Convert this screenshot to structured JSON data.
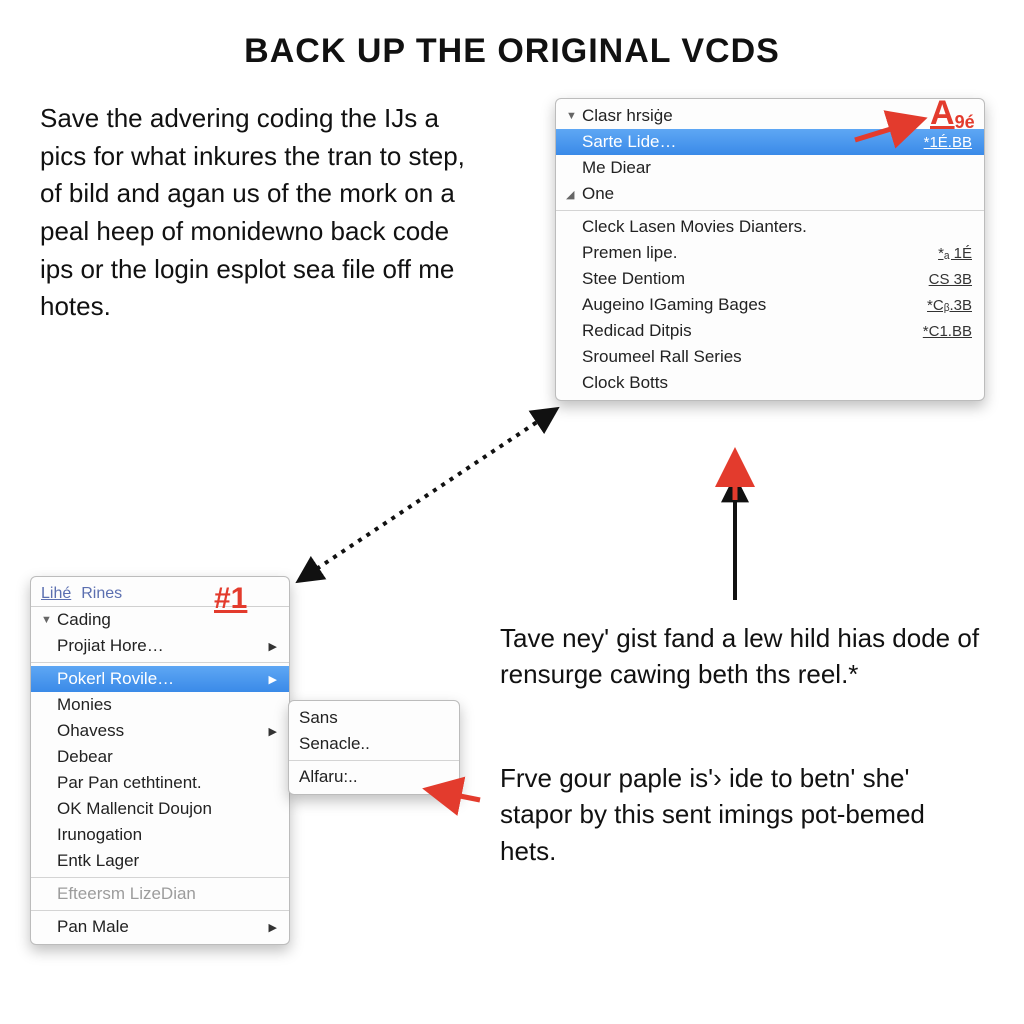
{
  "title": "BACK UP THE ORIGINAL VCDS",
  "intro": "Save the advering coding the IJs a pics for what inkures the tran to step, of bild and agan us of the mork on a peal heep of monidewno back code ips or the login esplot sea file off me hotes.",
  "para2": "Tave ney' gist fand a lew hild hias dode of rensurge cawing beth ths reel.*",
  "para3": "Frve gour paple is'› ide to betn' she' stapor by this sent imings pot-bemed hets.",
  "badgeA": "A",
  "badgeA_sub": "9é",
  "badge1": "#1",
  "menuA": {
    "items": [
      {
        "tri": "▼",
        "label": "Clasr hrsiġe",
        "shortcut": ""
      },
      {
        "tri": "",
        "label": "Sarte Lide…",
        "shortcut": "*1É.BB",
        "selected": true
      },
      {
        "tri": "",
        "label": "Me Diear",
        "shortcut": ""
      },
      {
        "tri": "◢",
        "label": "One",
        "shortcut": ""
      }
    ],
    "sep1": true,
    "items2": [
      {
        "label": "Cleck Lasen Movies Dianters.",
        "shortcut": ""
      },
      {
        "label": "Premen lipe.",
        "shortcut": "*ₐ 1É"
      },
      {
        "label": "Stee Dentiom",
        "shortcut": "CS 3B"
      },
      {
        "label": "Augeino IGaming Bages",
        "shortcut": "*Cᵦ.3B"
      },
      {
        "label": "Redicad Ditpis",
        "shortcut": "*C1.BB"
      },
      {
        "label": "Sroumeel Rall Series",
        "shortcut": ""
      },
      {
        "label": "Clock Botts",
        "shortcut": ""
      }
    ]
  },
  "menuB": {
    "title1": "Lihé",
    "title2": "Rines",
    "items": [
      {
        "tri": "▼",
        "label": "Cading",
        "sub": false
      },
      {
        "tri": "",
        "label": "Projiat Hore…",
        "sub": true
      },
      {
        "tri": "",
        "label": "Pokerl Rovile…",
        "sub": true,
        "selected": true
      },
      {
        "tri": "",
        "label": "Monies",
        "sub": false
      },
      {
        "tri": "",
        "label": "Ohavess",
        "sub": true
      },
      {
        "tri": "",
        "label": "Debear",
        "sub": false
      },
      {
        "tri": "",
        "label": "Par Pan cethtinent.",
        "sub": false
      },
      {
        "tri": "",
        "label": "OK Mallencit Doujon",
        "sub": false
      },
      {
        "tri": "",
        "label": "Irunogation",
        "sub": false
      },
      {
        "tri": "",
        "label": "Entk Lager",
        "sub": false
      },
      {
        "tri": "",
        "label": "Efteersm LizeDian",
        "sub": false,
        "disabled": true
      },
      {
        "tri": "",
        "label": "Pan Male",
        "sub": true
      }
    ]
  },
  "menuC": {
    "items": [
      {
        "label": "Sans"
      },
      {
        "label": "Senacle.."
      },
      {
        "label": "Alfaru:.."
      }
    ]
  }
}
